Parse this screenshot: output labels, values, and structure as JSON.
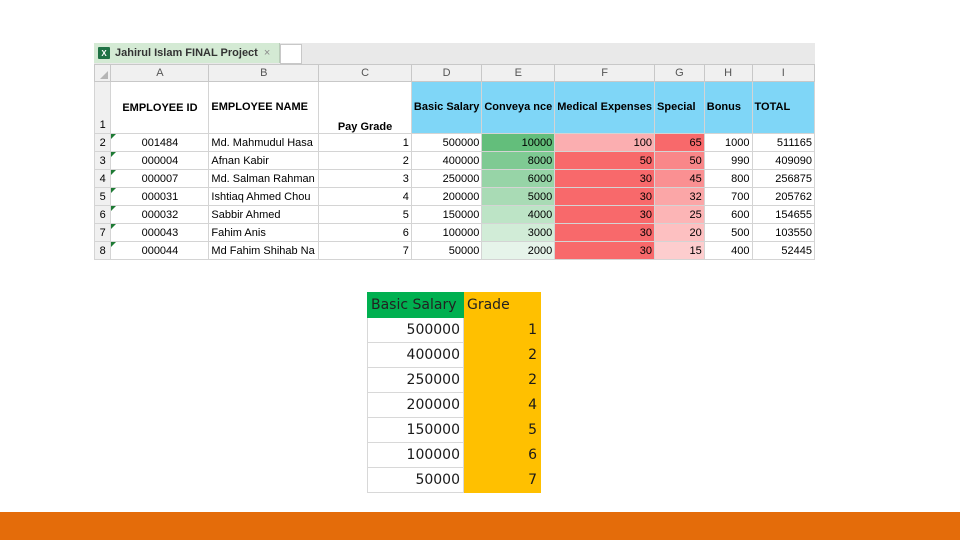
{
  "window": {
    "tab_title": "Jahirul Islam FINAL Project",
    "tab_close": "×",
    "app_icon": "excel-icon",
    "app_icon_glyph": "X"
  },
  "sheet": {
    "columns": [
      "A",
      "B",
      "C",
      "D",
      "E",
      "F",
      "G",
      "H",
      "I"
    ],
    "row_numbers": [
      "1",
      "2",
      "3",
      "4",
      "5",
      "6",
      "7",
      "8"
    ],
    "headers": {
      "employee_id": "EMPLOYEE ID",
      "employee_name": "EMPLOYEE NAME",
      "pay_grade": "Pay Grade",
      "basic_salary": "Basic Salary",
      "conveyance": "Conveya nce",
      "medical": "Medical Expenses",
      "special": "Special",
      "bonus": "Bonus",
      "total": "TOTAL"
    },
    "rows": [
      {
        "id": "001484",
        "name": "Md. Mahmudul Hasa",
        "grade": "1",
        "salary": "500000",
        "conv": "10000",
        "med": "100",
        "special": "65",
        "bonus": "1000",
        "total": "511165"
      },
      {
        "id": "000004",
        "name": "Afnan Kabir",
        "grade": "2",
        "salary": "400000",
        "conv": "8000",
        "med": "50",
        "special": "50",
        "bonus": "990",
        "total": "409090"
      },
      {
        "id": "000007",
        "name": "Md. Salman Rahman",
        "grade": "3",
        "salary": "250000",
        "conv": "6000",
        "med": "30",
        "special": "45",
        "bonus": "800",
        "total": "256875"
      },
      {
        "id": "000031",
        "name": "Ishtiaq Ahmed Chou",
        "grade": "4",
        "salary": "200000",
        "conv": "5000",
        "med": "30",
        "special": "32",
        "bonus": "700",
        "total": "205762"
      },
      {
        "id": "000032",
        "name": "Sabbir Ahmed",
        "grade": "5",
        "salary": "150000",
        "conv": "4000",
        "med": "30",
        "special": "25",
        "bonus": "600",
        "total": "154655"
      },
      {
        "id": "000043",
        "name": "Fahim Anis",
        "grade": "6",
        "salary": "100000",
        "conv": "3000",
        "med": "30",
        "special": "20",
        "bonus": "500",
        "total": "103550"
      },
      {
        "id": "000044",
        "name": "Md Fahim Shihab Na",
        "grade": "7",
        "salary": "50000",
        "conv": "2000",
        "med": "30",
        "special": "15",
        "bonus": "400",
        "total": "52445"
      }
    ],
    "colors": {
      "header_blue": "#7fd6f7",
      "conveyance_scale": [
        "#63be7b",
        "#7fca93",
        "#97d4a7",
        "#a9dbb5",
        "#bde4c6",
        "#d1ecd7",
        "#e6f4ea"
      ],
      "medical_scale": [
        "#fbaeb0",
        "#f8696b",
        "#f8696b",
        "#f8696b",
        "#f8696b",
        "#f8696b",
        "#f8696b"
      ],
      "special_scale": [
        "#f8696b",
        "#f98789",
        "#fa9092",
        "#fba6a7",
        "#fcb5b6",
        "#fdc0c1",
        "#fdcdce"
      ]
    }
  },
  "lookup": {
    "header_salary": "Basic Salary",
    "header_grade": "Grade",
    "rows": [
      {
        "salary": "500000",
        "grade": "1"
      },
      {
        "salary": "400000",
        "grade": "2"
      },
      {
        "salary": "250000",
        "grade": "2"
      },
      {
        "salary": "200000",
        "grade": "4"
      },
      {
        "salary": "150000",
        "grade": "5"
      },
      {
        "salary": "100000",
        "grade": "6"
      },
      {
        "salary": "50000",
        "grade": "7"
      }
    ],
    "colors": {
      "salary_header": "#00b050",
      "grade_fill": "#ffc000"
    }
  },
  "footer": {
    "color": "#e46c0a"
  }
}
